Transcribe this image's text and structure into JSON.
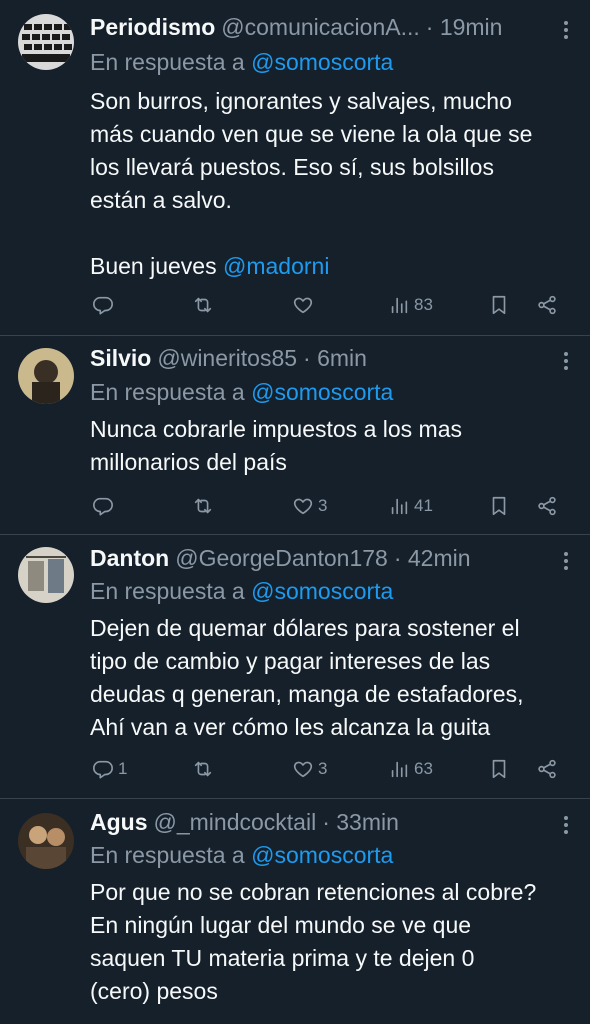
{
  "tweets": [
    {
      "name": "Periodismo",
      "handle": "@comunicacionA...",
      "time": "· 19min",
      "reply_prefix": "En respuesta a",
      "reply_to": "@somoscorta",
      "lines": [
        "Son burros, ignorantes y salvajes, mucho",
        "más cuando ven que se viene la ola que se",
        "los llevará puestos. Eso sí, sus bolsillos",
        "están a salvo."
      ],
      "extra_text": "Buen jueves",
      "extra_mention": "@madorni",
      "replies": "",
      "retweets": "",
      "likes": "",
      "views": "83"
    },
    {
      "name": "Silvio",
      "handle": "@wineritos85",
      "time": "· 6min",
      "reply_prefix": "En respuesta a",
      "reply_to": "@somoscorta",
      "lines": [
        "Nunca cobrarle impuestos a los mas",
        "millonarios del país"
      ],
      "replies": "",
      "retweets": "",
      "likes": "3",
      "views": "41"
    },
    {
      "name": "Danton",
      "handle": "@GeorgeDanton178",
      "time": "· 42min",
      "reply_prefix": "En respuesta a",
      "reply_to": "@somoscorta",
      "lines": [
        "Dejen de quemar dólares para sostener el",
        "tipo de cambio y pagar intereses de las",
        "deudas q generan, manga de estafadores,",
        "Ahí van a ver cómo les alcanza la guita"
      ],
      "replies": "1",
      "retweets": "",
      "likes": "3",
      "views": "63"
    },
    {
      "name": "Agus",
      "handle": "@_mindcocktail",
      "time": "· 33min",
      "reply_prefix": "En respuesta a",
      "reply_to": "@somoscorta",
      "lines": [
        "Por que no se cobran retenciones al cobre?",
        "En ningún lugar del mundo se ve que",
        "saquen TU materia prima y te dejen 0",
        "(cero) pesos"
      ]
    }
  ],
  "colors": {
    "background": "#15202b",
    "text": "#f7f9f9",
    "muted": "#8b98a5",
    "accent": "#1d9bf0",
    "divider": "#38444d"
  },
  "icons": [
    "reply-icon",
    "retweet-icon",
    "like-icon",
    "views-icon",
    "bookmark-icon",
    "share-icon",
    "more-icon"
  ]
}
